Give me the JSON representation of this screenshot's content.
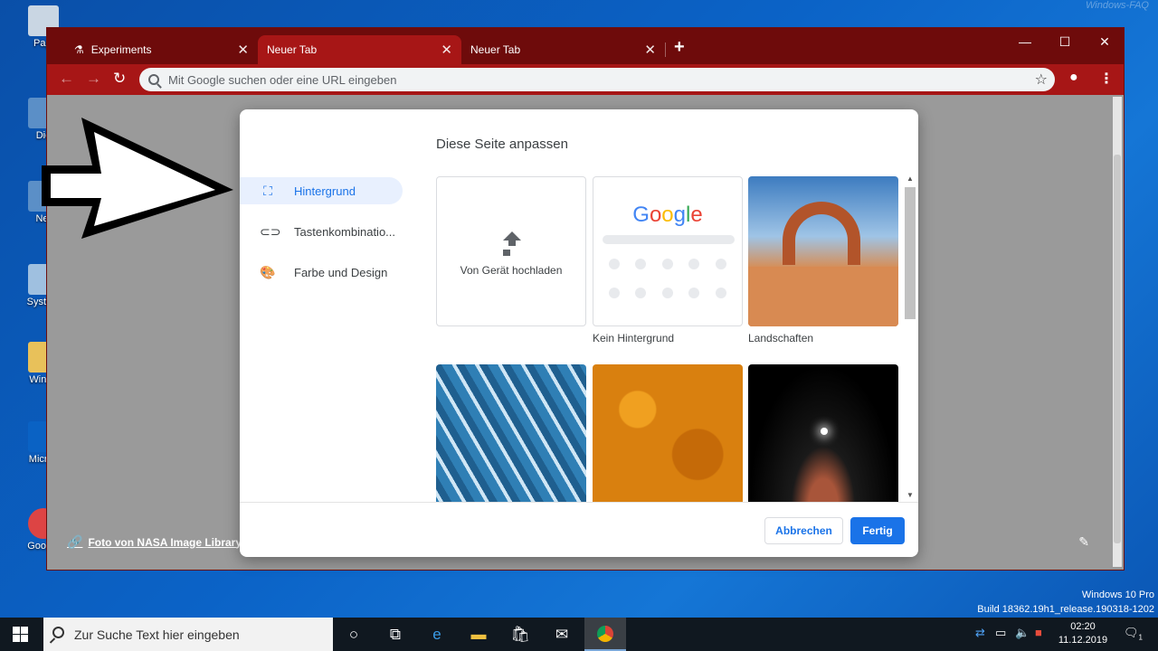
{
  "desktop": {
    "watermark": "Windows-FAQ",
    "icons": [
      "Papi",
      "Die",
      "Net",
      "System",
      "Windo",
      "Micros",
      "Google"
    ]
  },
  "window": {
    "tabs": [
      {
        "label": "Experiments",
        "icon": "flask-icon"
      },
      {
        "label": "Neuer Tab",
        "active": true
      },
      {
        "label": "Neuer Tab"
      }
    ],
    "omnibox_placeholder": "Mit Google suchen oder eine URL eingeben",
    "theme_color": "#a71616",
    "frame_color": "#6e0b0b"
  },
  "page": {
    "photo_credit": "Foto von NASA Image Library"
  },
  "dialog": {
    "title": "Diese Seite anpassen",
    "menu": [
      {
        "label": "Hintergrund",
        "icon": "wallpaper-icon",
        "active": true
      },
      {
        "label": "Tastenkombinatio...",
        "icon": "link-icon"
      },
      {
        "label": "Farbe und Design",
        "icon": "palette-icon"
      }
    ],
    "tiles": {
      "upload_label": "Von Gerät hochladen",
      "no_background_label": "Kein Hintergrund",
      "google_logo": "Google",
      "landscapes_label": "Landschaften"
    },
    "cancel": "Abbrechen",
    "done": "Fertig"
  },
  "system": {
    "winver_line1": "Windows 10 Pro",
    "winver_line2": "Build 18362.19h1_release.190318-1202",
    "taskbar_search": "Zur Suche Text hier eingeben",
    "time": "02:20",
    "date": "11.12.2019",
    "notification_count": "1"
  }
}
